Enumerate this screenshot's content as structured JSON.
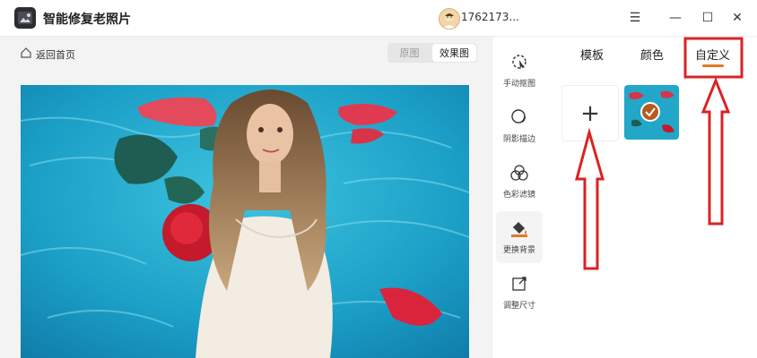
{
  "app": {
    "title": "智能修复老照片",
    "user_id": "1762173..."
  },
  "window_controls": {
    "menu": "☰",
    "minimize": "—",
    "maximize": "☐",
    "close": "✕"
  },
  "editor": {
    "back_label": "返回首页",
    "toggle": [
      "原图",
      "效果图"
    ],
    "toggle_active": 1
  },
  "tools": [
    {
      "label": "手动抠图",
      "icon": "cursor-select-icon",
      "active": false
    },
    {
      "label": "阴影描边",
      "icon": "shadow-circle-icon",
      "active": false
    },
    {
      "label": "色彩滤镜",
      "icon": "color-filter-icon",
      "active": false
    },
    {
      "label": "更换背景",
      "icon": "paint-bucket-icon",
      "active": true
    },
    {
      "label": "调整尺寸",
      "icon": "resize-icon",
      "active": false
    }
  ],
  "panel": {
    "tabs": [
      "模板",
      "颜色",
      "自定义"
    ],
    "active_tab": 2,
    "add_tile": "+"
  },
  "colors": {
    "accent": "#e07a22",
    "annotation_red": "#d92323",
    "water": "#1fa6c9"
  }
}
